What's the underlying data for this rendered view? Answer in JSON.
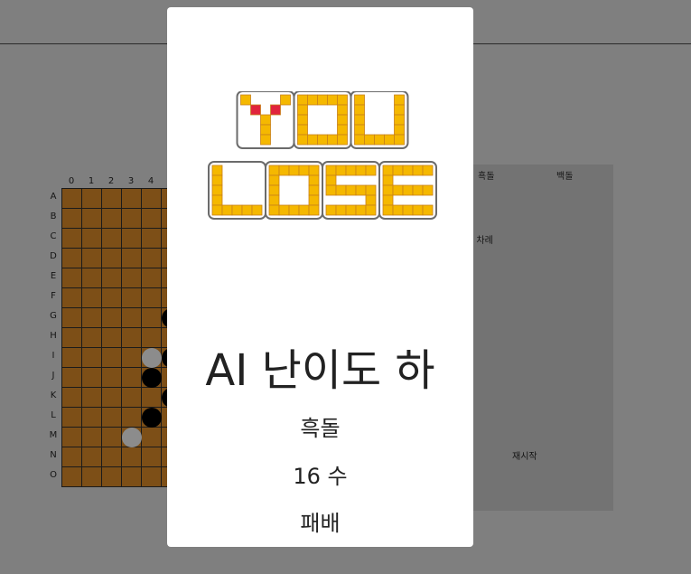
{
  "board": {
    "col_labels": [
      "0",
      "1",
      "2",
      "3",
      "4"
    ],
    "row_labels": [
      "A",
      "B",
      "C",
      "D",
      "E",
      "F",
      "G",
      "H",
      "I",
      "J",
      "K",
      "L",
      "M",
      "N",
      "O"
    ],
    "stones": [
      {
        "row": 6,
        "col": 5,
        "color": "black"
      },
      {
        "row": 8,
        "col": 4,
        "color": "ghost"
      },
      {
        "row": 8,
        "col": 5,
        "color": "black"
      },
      {
        "row": 9,
        "col": 4,
        "color": "black"
      },
      {
        "row": 10,
        "col": 5,
        "color": "black"
      },
      {
        "row": 11,
        "col": 4,
        "color": "black"
      },
      {
        "row": 12,
        "col": 3,
        "color": "ghost"
      }
    ]
  },
  "panel": {
    "black_label": "흑돌",
    "white_label": "백돌",
    "turn_text": "신 차례",
    "restart_label": "재시작"
  },
  "modal": {
    "logo_text": "YOU LOSE",
    "title": "AI 난이도 하",
    "stone_color": "흑돌",
    "moves": "16 수",
    "result": "패배"
  },
  "colors": {
    "overlay": "#7f7f7f",
    "board_wood": "#7d4f17",
    "logo_fill": "#f5b800",
    "logo_accent": "#e0243c"
  }
}
